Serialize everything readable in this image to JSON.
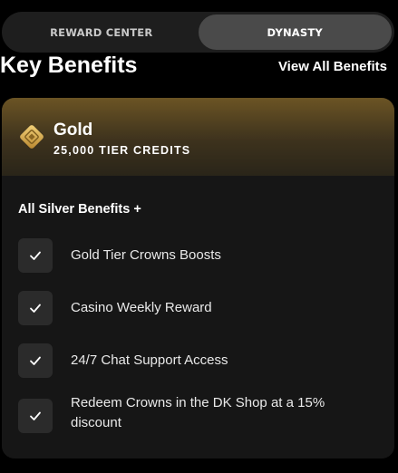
{
  "tabs": [
    {
      "label": "REWARD CENTER",
      "active": false
    },
    {
      "label": "DYNASTY",
      "active": true
    }
  ],
  "section": {
    "title": "Key Benefits",
    "view_all_label": "View All Benefits"
  },
  "tier": {
    "name": "Gold",
    "credits": "25,000 TIER CREDITS",
    "icon": "gold-diamond-icon",
    "accent_color": "#c9a24a"
  },
  "benefits": {
    "heading": "All Silver Benefits +",
    "items": [
      {
        "label": "Gold Tier Crowns Boosts"
      },
      {
        "label": "Casino Weekly Reward"
      },
      {
        "label": "24/7 Chat Support Access"
      },
      {
        "label": "Redeem Crowns in the DK Shop at a 15% discount"
      }
    ]
  }
}
